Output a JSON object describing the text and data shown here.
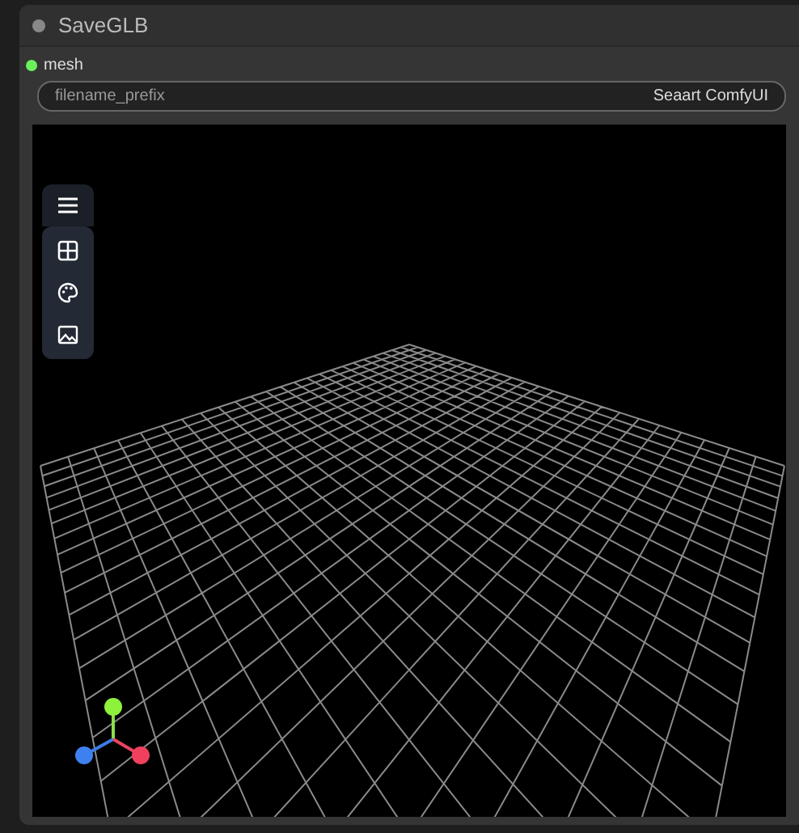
{
  "node": {
    "title": "SaveGLB"
  },
  "inputs": [
    {
      "name": "mesh",
      "color": "#6cf05c"
    }
  ],
  "widgets": [
    {
      "label": "filename_prefix",
      "value": "Seaart ComfyUI"
    }
  ]
}
